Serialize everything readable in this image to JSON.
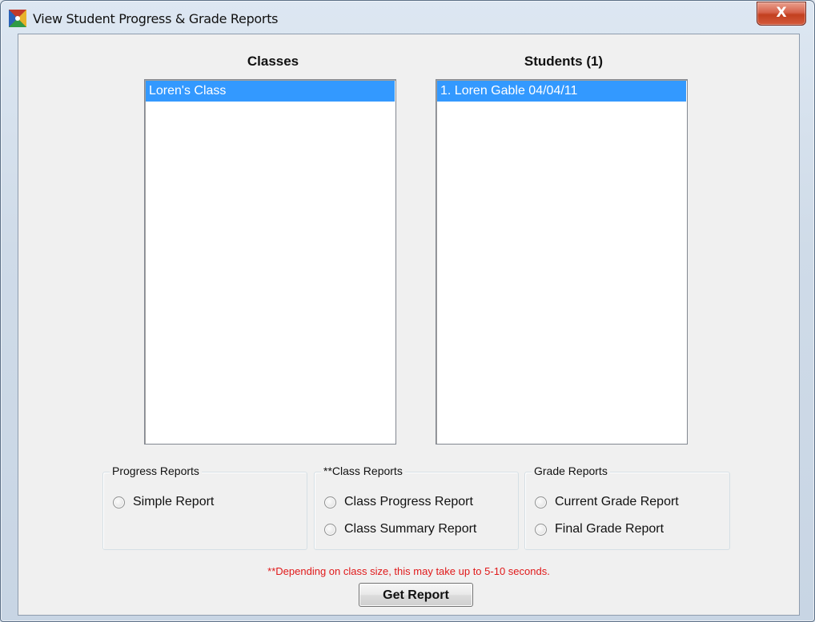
{
  "window": {
    "title": "View Student Progress & Grade Reports",
    "close_label": "X"
  },
  "classes": {
    "header": "Classes",
    "items": [
      "Loren's Class"
    ]
  },
  "students": {
    "header": "Students (1)",
    "items": [
      "1. Loren Gable  04/04/11"
    ]
  },
  "progress_reports": {
    "label": "Progress Reports",
    "options": [
      "Simple Report"
    ]
  },
  "class_reports": {
    "label": "**Class Reports",
    "options": [
      "Class Progress Report",
      "Class Summary Report"
    ]
  },
  "grade_reports": {
    "label": "Grade Reports",
    "options": [
      "Current Grade Report",
      "Final Grade Report"
    ]
  },
  "note": "**Depending on class size, this may take up to 5-10 seconds.",
  "get_report_label": "Get Report",
  "colors": {
    "selection": "#3399ff",
    "note": "#e0191a"
  }
}
